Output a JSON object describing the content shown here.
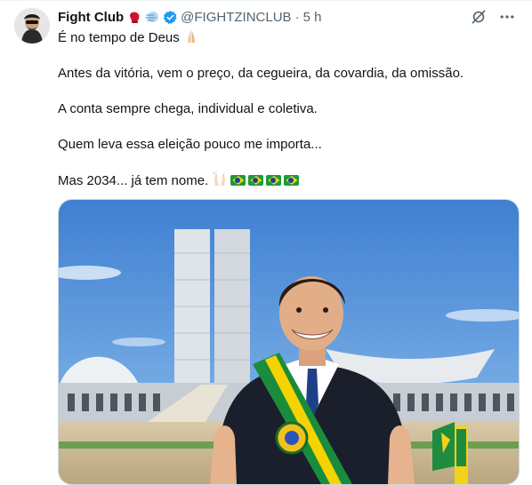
{
  "tweet": {
    "author_name": "Fight Club",
    "handle": "@FIGHTZINCLUB",
    "separator": "·",
    "time": "5 h",
    "badges": [
      "boxing-glove-icon",
      "wind-icon",
      "verified-badge-icon"
    ],
    "lines": [
      "É no tempo de Deus",
      "Antes da vitória, vem o preço, da cegueira, da covardia, da omissão.",
      "A conta sempre chega, individual e coletiva.",
      "Quem leva essa eleição pouco me importa...",
      "Mas 2034... já tem nome."
    ],
    "emojis": [
      "praying-hands",
      "raised-hands",
      "brazil-flag",
      "brazil-flag",
      "brazil-flag",
      "brazil-flag"
    ]
  },
  "colors": {
    "verified": "#1d9bf0",
    "secondary_text": "#536471",
    "sky": "#4a8fd8",
    "sash_green": "#1a8c3c",
    "sash_yellow": "#f5d300"
  },
  "actions": [
    "grok-icon",
    "more-icon"
  ]
}
